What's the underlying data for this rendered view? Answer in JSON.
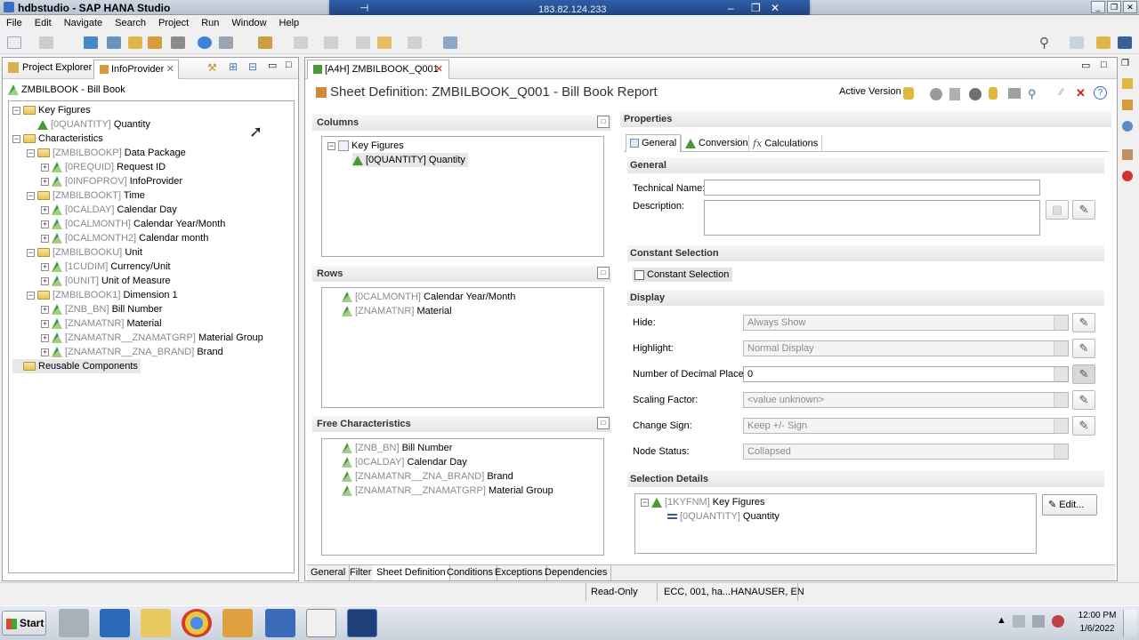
{
  "window": {
    "title": "hdbstudio - SAP HANA Studio",
    "rdp_ip": "183.82.124.233"
  },
  "menu": [
    "File",
    "Edit",
    "Navigate",
    "Search",
    "Project",
    "Run",
    "Window",
    "Help"
  ],
  "left": {
    "tabs": [
      "Project Explorer",
      "InfoProvider"
    ],
    "root": "ZMBILBOOK - Bill Book",
    "tree": [
      {
        "tech": "",
        "label": "Key Figures",
        "type": "folder",
        "indent": 0,
        "pm": "-"
      },
      {
        "tech": "[0QUANTITY]",
        "label": "Quantity",
        "type": "kf",
        "indent": 1,
        "pm": ""
      },
      {
        "tech": "",
        "label": "Characteristics",
        "type": "folder",
        "indent": 0,
        "pm": "-"
      },
      {
        "tech": "[ZMBILBOOKP]",
        "label": "Data Package",
        "type": "dimf",
        "indent": 1,
        "pm": "-"
      },
      {
        "tech": "[0REQUID]",
        "label": "Request ID",
        "type": "chr",
        "indent": 2,
        "pm": "+"
      },
      {
        "tech": "[0INFOPROV]",
        "label": "InfoProvider",
        "type": "chr",
        "indent": 2,
        "pm": "+"
      },
      {
        "tech": "[ZMBILBOOKT]",
        "label": "Time",
        "type": "dimf",
        "indent": 1,
        "pm": "-"
      },
      {
        "tech": "[0CALDAY]",
        "label": "Calendar Day",
        "type": "chr",
        "indent": 2,
        "pm": "+"
      },
      {
        "tech": "[0CALMONTH]",
        "label": "Calendar Year/Month",
        "type": "chr",
        "indent": 2,
        "pm": "+"
      },
      {
        "tech": "[0CALMONTH2]",
        "label": "Calendar month",
        "type": "chr",
        "indent": 2,
        "pm": "+"
      },
      {
        "tech": "[ZMBILBOOKU]",
        "label": "Unit",
        "type": "dimf",
        "indent": 1,
        "pm": "-"
      },
      {
        "tech": "[1CUDIM]",
        "label": "Currency/Unit",
        "type": "chr",
        "indent": 2,
        "pm": "+"
      },
      {
        "tech": "[0UNIT]",
        "label": "Unit of Measure",
        "type": "chr",
        "indent": 2,
        "pm": "+"
      },
      {
        "tech": "[ZMBILBOOK1]",
        "label": "Dimension 1",
        "type": "dimf",
        "indent": 1,
        "pm": "-"
      },
      {
        "tech": "[ZNB_BN]",
        "label": "Bill Number",
        "type": "chr",
        "indent": 2,
        "pm": "+"
      },
      {
        "tech": "[ZNAMATNR]",
        "label": "Material",
        "type": "chr",
        "indent": 2,
        "pm": "+"
      },
      {
        "tech": "[ZNAMATNR__ZNAMATGRP]",
        "label": "Material Group",
        "type": "chr",
        "indent": 2,
        "pm": "+"
      },
      {
        "tech": "[ZNAMATNR__ZNA_BRAND]",
        "label": "Brand",
        "type": "chr",
        "indent": 2,
        "pm": "+"
      },
      {
        "tech": "",
        "label": "Reusable Components",
        "type": "folder",
        "indent": 0,
        "pm": ""
      }
    ]
  },
  "editor": {
    "tab": "[A4H] ZMBILBOOK_Q001",
    "heading": "Sheet Definition: ZMBILBOOK_Q001 - Bill Book Report",
    "active_version": "Active Version",
    "columns": {
      "title": "Columns",
      "items": [
        {
          "tech": "",
          "label": "Key Figures"
        },
        {
          "tech": "[0QUANTITY]",
          "label": "Quantity"
        }
      ]
    },
    "rows": {
      "title": "Rows",
      "items": [
        {
          "tech": "[0CALMONTH]",
          "label": "Calendar Year/Month"
        },
        {
          "tech": "[ZNAMATNR]",
          "label": "Material"
        }
      ]
    },
    "free": {
      "title": "Free Characteristics",
      "items": [
        {
          "tech": "[ZNB_BN]",
          "label": "Bill Number"
        },
        {
          "tech": "[0CALDAY]",
          "label": "Calendar Day"
        },
        {
          "tech": "[ZNAMATNR__ZNA_BRAND]",
          "label": "Brand"
        },
        {
          "tech": "[ZNAMATNR__ZNAMATGRP]",
          "label": "Material Group"
        }
      ]
    },
    "bottom_tabs": [
      "General",
      "Filter",
      "Sheet Definition",
      "Conditions",
      "Exceptions",
      "Dependencies"
    ]
  },
  "properties": {
    "title": "Properties",
    "tabs": [
      "General",
      "Conversion",
      "Calculations"
    ],
    "general": {
      "title": "General",
      "technical_name_label": "Technical Name:",
      "technical_name": "",
      "description_label": "Description:"
    },
    "constant": {
      "title": "Constant Selection",
      "checkbox_label": "Constant Selection"
    },
    "display": {
      "title": "Display",
      "fields": [
        {
          "label": "Hide:",
          "value": "Always Show"
        },
        {
          "label": "Highlight:",
          "value": "Normal Display"
        },
        {
          "label": "Number of Decimal Places:",
          "value": "0"
        },
        {
          "label": "Scaling Factor:",
          "value": "<value unknown>"
        },
        {
          "label": "Change Sign:",
          "value": "Keep +/- Sign"
        },
        {
          "label": "Node Status:",
          "value": "Collapsed"
        }
      ]
    },
    "selection": {
      "title": "Selection Details",
      "tech1": "[1KYFNM]",
      "label1": "Key Figures",
      "tech2": "[0QUANTITY]",
      "label2": "Quantity",
      "edit": "Edit..."
    }
  },
  "status": {
    "mode": "Read-Only",
    "conn": "ECC, 001, ha...HANAUSER, EN"
  },
  "taskbar": {
    "start": "Start",
    "time": "12:00 PM",
    "date": "1/6/2022"
  }
}
